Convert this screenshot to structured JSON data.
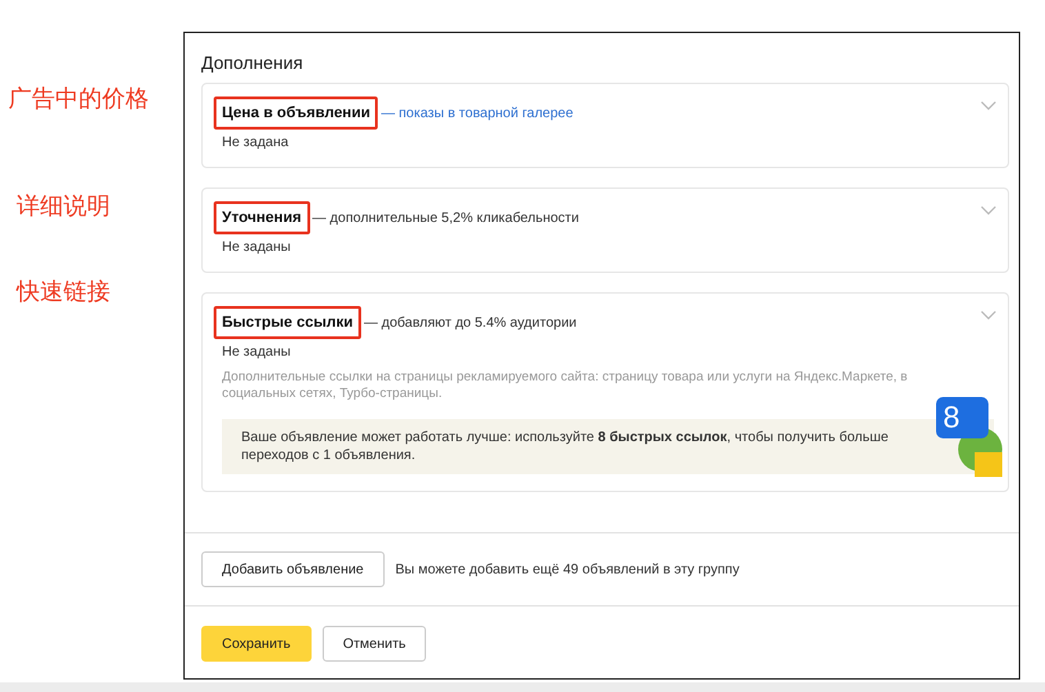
{
  "annotations": [
    "广告中的价格",
    "详细说明",
    "快速链接"
  ],
  "panel": {
    "title": "Дополнения",
    "cards": [
      {
        "title": "Цена в объявлении",
        "hint": "— показы в товарной галерее",
        "hint_link": true,
        "highlighted": true,
        "status": "Не задана",
        "expanded": false
      },
      {
        "title": "Уточнения",
        "hint": "— дополнительные 5,2% кликабельности",
        "hint_link": false,
        "highlighted": true,
        "status": "Не заданы",
        "expanded": false
      },
      {
        "title": "Быстрые ссылки",
        "hint": "— добавляют до 5.4% аудитории",
        "hint_link": false,
        "highlighted": true,
        "status": "Не заданы",
        "expanded": false,
        "description": "Дополнительные ссылки на страницы рекламируемого сайта: страницу товара или услуги на Яндекс.Маркете, в социальных сетях, Турбо-страницы.",
        "tip": "Ваше объявление может работать лучше: используйте **8 быстрых ссылок**, чтобы получить больше переходов с 1 объявления.",
        "tip_badge": "8"
      }
    ],
    "add_button": "Добавить объявление",
    "add_note": "Вы можете добавить ещё 49 объявлений в эту группу",
    "save_button": "Сохранить",
    "cancel_button": "Отменить"
  }
}
